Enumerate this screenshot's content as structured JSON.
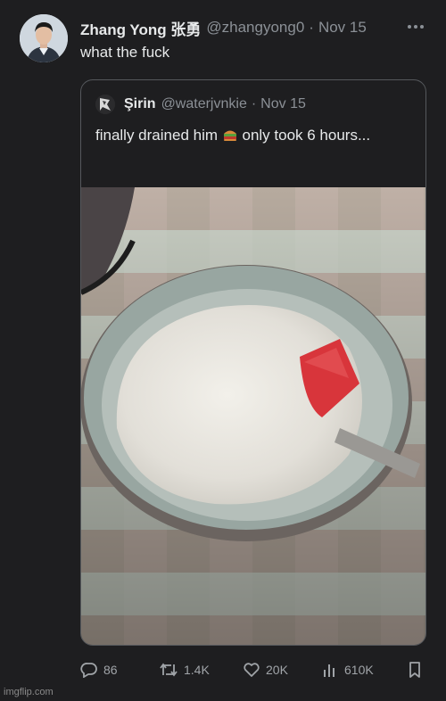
{
  "tweet": {
    "display_name": "Zhang Yong 张勇",
    "handle": "@zhangyong0",
    "separator": "·",
    "date": "Nov 15",
    "text": "what the fuck",
    "avatar_icon": "person-avatar"
  },
  "quoted_tweet": {
    "display_name": "Şirin",
    "handle": "@waterjvnkie",
    "separator": "·",
    "date": "Nov 15",
    "text_part1": "finally drained him",
    "text_part2": "only took 6 hours...",
    "emoji_icon": "sandwich-emoji",
    "avatar_icon": "dark-avatar",
    "image_description_icon": "bowl-photo"
  },
  "actions": {
    "replies": "86",
    "retweets": "1.4K",
    "likes": "20K",
    "views": "610K"
  },
  "watermark": "imgflip.com",
  "colors": {
    "background": "#1e1e20",
    "text": "#e7e9ea",
    "muted": "#8b9096",
    "border": "#55585c"
  }
}
